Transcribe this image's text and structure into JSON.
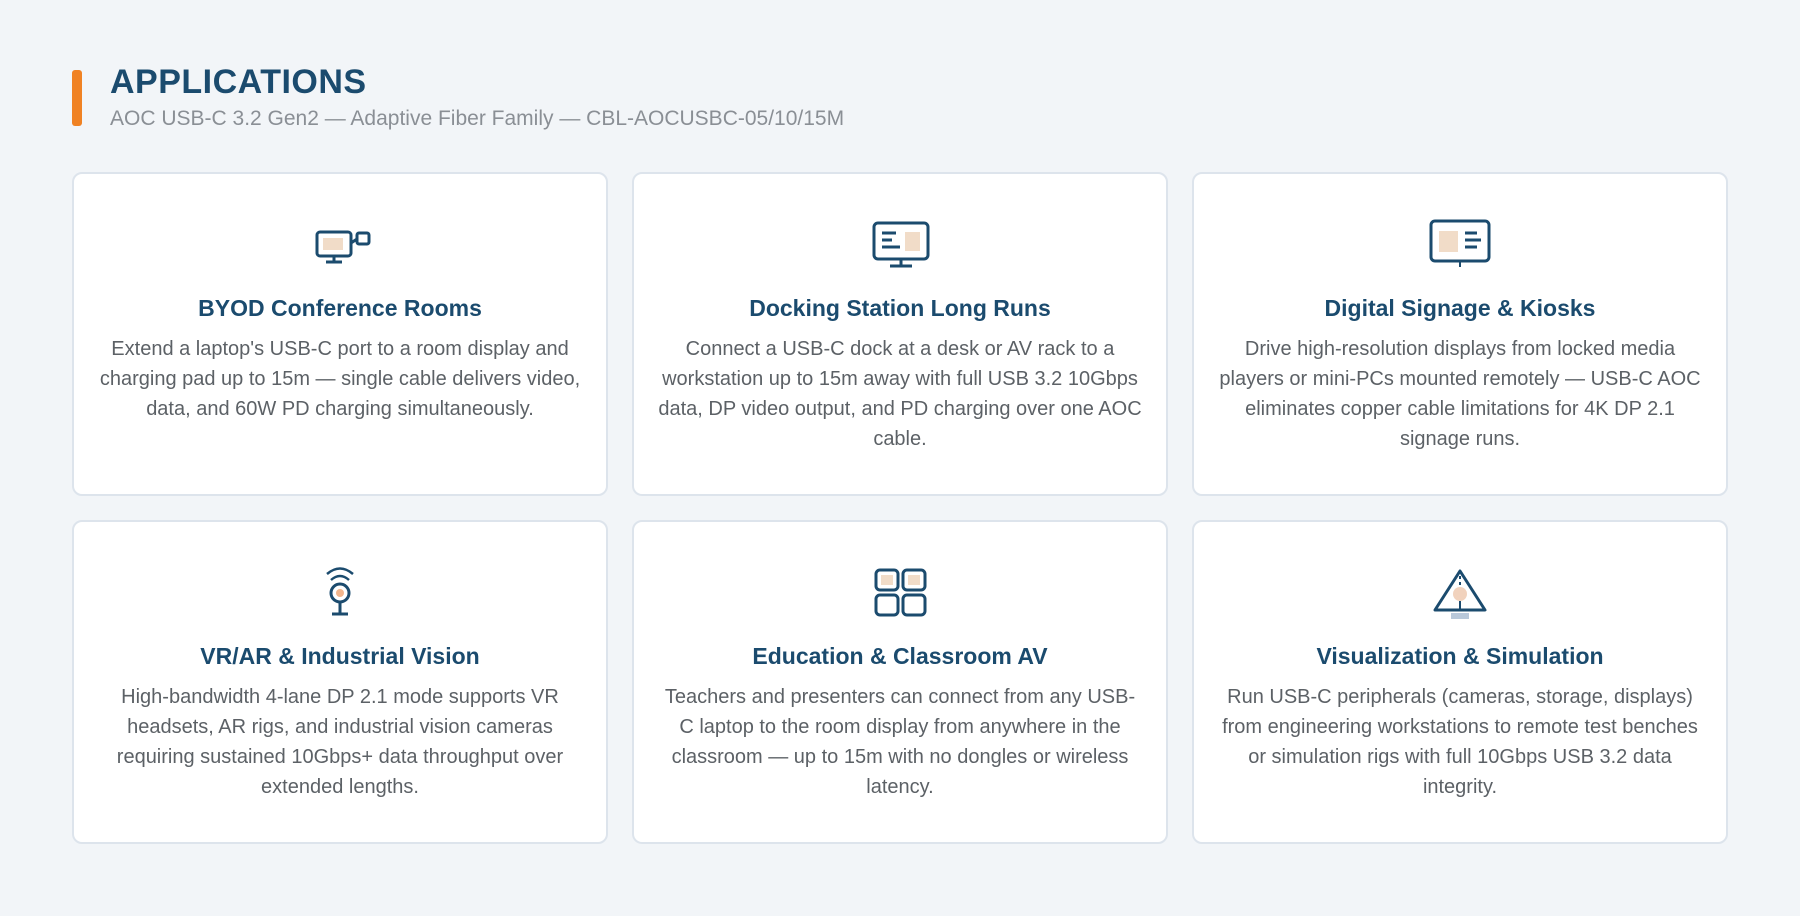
{
  "header": {
    "title": "APPLICATIONS",
    "subtitle": "AOC USB-C 3.2 Gen2 — Adaptive Fiber Family — CBL-AOCUSBC-05/10/15M"
  },
  "colors": {
    "accent": "#f08223",
    "title": "#1b4b6e",
    "icon_stroke": "#1b4b6e",
    "icon_fill": "#f1dcc8"
  },
  "cards": [
    {
      "icon": "laptop-display-icon",
      "title": "BYOD Conference Rooms",
      "description": "Extend a laptop's USB-C port to a room display and charging pad up to 15m — single cable delivers video, data, and 60W PD charging simultaneously."
    },
    {
      "icon": "docking-monitor-icon",
      "title": "Docking Station Long Runs",
      "description": "Connect a USB-C dock at a desk or AV rack to a workstation up to 15m away with full USB 3.2 10Gbps data, DP video output, and PD charging over one AOC cable."
    },
    {
      "icon": "signage-display-icon",
      "title": "Digital Signage & Kiosks",
      "description": "Drive high-resolution displays from locked media players or mini-PCs mounted remotely — USB-C AOC eliminates copper cable limitations for 4K DP 2.1 signage runs."
    },
    {
      "icon": "camera-signal-icon",
      "title": "VR/AR & Industrial Vision",
      "description": "High-bandwidth 4-lane DP 2.1 mode supports VR headsets, AR rigs, and industrial vision cameras requiring sustained 10Gbps+ data throughput over extended lengths."
    },
    {
      "icon": "grid-panels-icon",
      "title": "Education & Classroom AV",
      "description": "Teachers and presenters can connect from any USB-C laptop to the room display from anywhere in the classroom — up to 15m with no dongles or wireless latency."
    },
    {
      "icon": "triangle-projector-icon",
      "title": "Visualization & Simulation",
      "description": "Run USB-C peripherals (cameras, storage, displays) from engineering workstations to remote test benches or simulation rigs with full 10Gbps USB 3.2 data integrity."
    }
  ]
}
